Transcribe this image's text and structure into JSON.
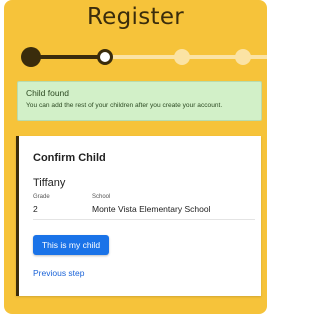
{
  "page": {
    "title": "Register"
  },
  "stepper": {
    "total_steps": 4,
    "current_step": 2,
    "colors": {
      "done": "#3a2c0c",
      "pending": "#fbe3a4",
      "current_fill": "#ffffff"
    }
  },
  "alert": {
    "title": "Child found",
    "message": "You can add the rest of your children after you create your account."
  },
  "confirm_card": {
    "title": "Confirm Child",
    "child_name": "Tiffany",
    "grade_label": "Grade",
    "grade_value": "2",
    "school_label": "School",
    "school_value": "Monte Vista Elementary School",
    "confirm_button_label": "This is my child",
    "previous_link_label": "Previous step"
  },
  "colors": {
    "background": "#f6c33a",
    "primary_button": "#1a73e8",
    "alert_background": "#d2f0c8",
    "card_accent": "#3a2c0c"
  }
}
